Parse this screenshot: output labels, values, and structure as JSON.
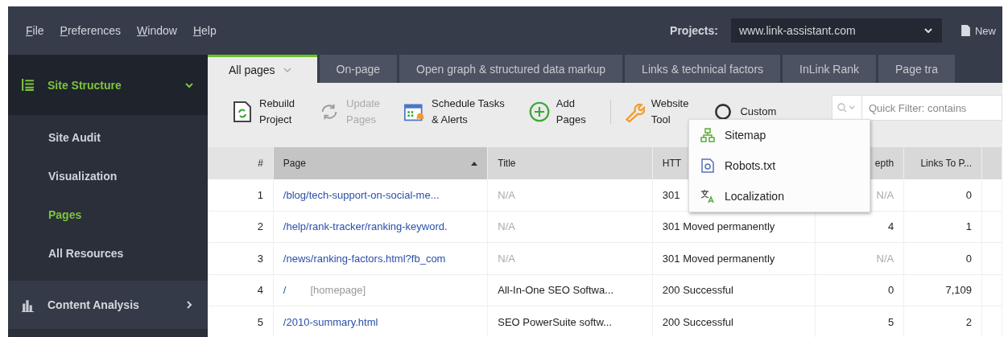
{
  "menu": [
    {
      "label": "File"
    },
    {
      "label": "Preferences"
    },
    {
      "label": "Window"
    },
    {
      "label": "Help"
    }
  ],
  "projects": {
    "label": "Projects:",
    "value": "www.link-assistant.com",
    "new_label": "New"
  },
  "sidebar": [
    {
      "label": "Site Structure",
      "kind": "tree",
      "expanded": true,
      "children": [
        {
          "label": "Site Audit",
          "selected": false
        },
        {
          "label": "Visualization",
          "selected": false
        },
        {
          "label": "Pages",
          "selected": true
        },
        {
          "label": "All Resources",
          "selected": false
        }
      ]
    },
    {
      "label": "Content Analysis",
      "kind": "chart",
      "expanded": false
    }
  ],
  "tabs": [
    {
      "label": "All pages",
      "selected": true
    },
    {
      "label": "On-page",
      "selected": false
    },
    {
      "label": "Open graph & structured data markup",
      "selected": false
    },
    {
      "label": "Links & technical factors",
      "selected": false
    },
    {
      "label": "InLink Rank",
      "selected": false
    },
    {
      "label": "Page tra",
      "selected": false
    }
  ],
  "toolbar": [
    {
      "kind": "rebuild",
      "lines": [
        "Rebuild",
        "Project"
      ],
      "disabled": false
    },
    {
      "kind": "update",
      "lines": [
        "Update",
        "Pages"
      ],
      "disabled": true
    },
    {
      "kind": "schedule",
      "lines": [
        "Schedule Tasks",
        "& Alerts"
      ],
      "disabled": false
    },
    {
      "kind": "add",
      "lines": [
        "Add",
        "Pages"
      ],
      "disabled": false
    },
    {
      "kind": "tools",
      "lines": [
        "Website",
        "Tool"
      ],
      "disabled": false
    },
    {
      "kind": "custom",
      "lines": [
        "Custom"
      ],
      "disabled": false
    }
  ],
  "search": {
    "placeholder": "Quick Filter: contains"
  },
  "dropdown": [
    {
      "kind": "sitemap",
      "label": "Sitemap"
    },
    {
      "kind": "robots",
      "label": "Robots.txt"
    },
    {
      "kind": "localization",
      "label": "Localization"
    }
  ],
  "table": {
    "columns": [
      {
        "label": "#",
        "sorted": false
      },
      {
        "label": "Page",
        "sorted": true
      },
      {
        "label": "Title",
        "sorted": false
      },
      {
        "label": "HTT",
        "sorted": false
      },
      {
        "label": "epth",
        "sorted": false
      },
      {
        "label": "Links To P...",
        "sorted": false
      }
    ],
    "rows": [
      {
        "num": "1",
        "page": "/blog/tech-support-on-social-me...",
        "title": {
          "text": "N/A",
          "muted": true
        },
        "status": "301",
        "depth": {
          "text": "N/A",
          "muted": true
        },
        "links": "0"
      },
      {
        "num": "2",
        "page": "/help/rank-tracker/ranking-keyword.",
        "title": {
          "text": "N/A",
          "muted": true
        },
        "status": "301 Moved permanently",
        "depth": {
          "text": "4",
          "muted": false
        },
        "links": "1"
      },
      {
        "num": "3",
        "page": "/news/ranking-factors.html?fb_com",
        "title": {
          "text": "N/A",
          "muted": true
        },
        "status": "301 Moved permanently",
        "depth": {
          "text": "N/A",
          "muted": true
        },
        "links": "0"
      },
      {
        "num": "4",
        "page": "/",
        "note": "[homepage]",
        "title": {
          "text": "All-In-One SEO Softwa...",
          "muted": false
        },
        "status": "200 Successful",
        "depth": {
          "text": "0",
          "muted": false
        },
        "links": "7,109"
      },
      {
        "num": "5",
        "page": "/2010-summary.html",
        "title": {
          "text": "SEO PowerSuite softw...",
          "muted": false
        },
        "status": "200 Successful",
        "depth": {
          "text": "5",
          "muted": false
        },
        "links": "2"
      }
    ]
  }
}
